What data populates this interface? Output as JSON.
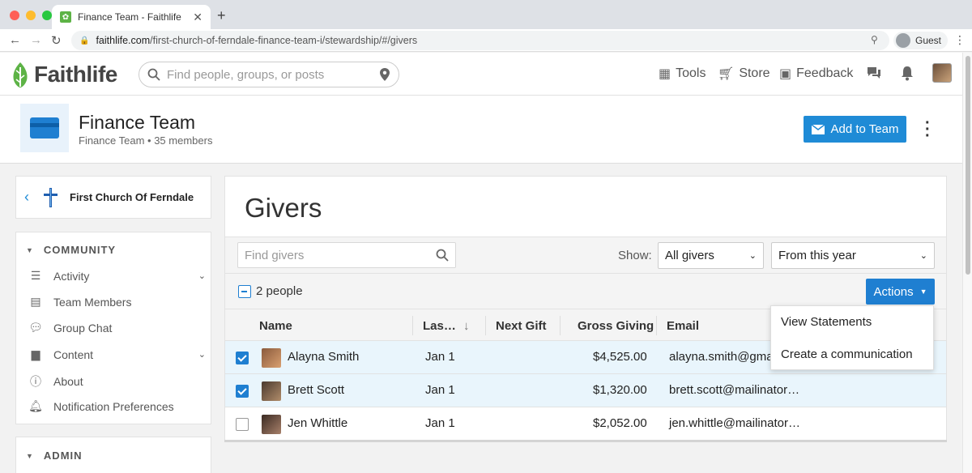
{
  "browser": {
    "tab_title": "Finance Team - Faithlife",
    "url_domain": "faithlife.com",
    "url_path": "/first-church-of-ferndale-finance-team-i/stewardship/#/givers",
    "profile_label": "Guest"
  },
  "header": {
    "logo_text": "Faithlife",
    "search_placeholder": "Find people, groups, or posts",
    "nav": {
      "tools": "Tools",
      "store": "Store",
      "feedback": "Feedback"
    }
  },
  "group": {
    "title": "Finance Team",
    "subtitle": "Finance Team  •  35 members",
    "add_button": "Add to Team"
  },
  "sidebar": {
    "church_name": "First Church Of Ferndale",
    "community_heading": "COMMUNITY",
    "items": [
      {
        "label": "Activity",
        "icon": "activity-icon",
        "expandable": true
      },
      {
        "label": "Team Members",
        "icon": "team-members-icon",
        "expandable": false
      },
      {
        "label": "Group Chat",
        "icon": "chat-icon",
        "expandable": false
      },
      {
        "label": "Content",
        "icon": "folder-icon",
        "expandable": true
      },
      {
        "label": "About",
        "icon": "info-icon",
        "expandable": false
      },
      {
        "label": "Notification Preferences",
        "icon": "bell-icon",
        "expandable": false
      }
    ],
    "admin_heading": "ADMIN"
  },
  "main": {
    "title": "Givers",
    "find_placeholder": "Find givers",
    "show_label": "Show:",
    "filter_givers": "All givers",
    "filter_period": "From this year",
    "selection_count": "2 people",
    "actions_label": "Actions",
    "columns": [
      "Name",
      "Las…",
      "Next Gift",
      "Gross Giving",
      "Email"
    ],
    "rows": [
      {
        "name": "Alayna Smith",
        "last": "Jan 1",
        "next": "",
        "gross": "$4,525.00",
        "email": "alayna.smith@gma",
        "checked": true
      },
      {
        "name": "Brett Scott",
        "last": "Jan 1",
        "next": "",
        "gross": "$1,320.00",
        "email": "brett.scott@mailinator…",
        "checked": true
      },
      {
        "name": "Jen Whittle",
        "last": "Jan 1",
        "next": "",
        "gross": "$2,052.00",
        "email": "jen.whittle@mailinator…",
        "checked": false
      }
    ],
    "actions_menu": [
      "View Statements",
      "Create a communication"
    ]
  },
  "colors": {
    "brand_green": "#5db346",
    "primary_blue": "#1f7fd1",
    "selected_row": "#e9f5fc"
  }
}
